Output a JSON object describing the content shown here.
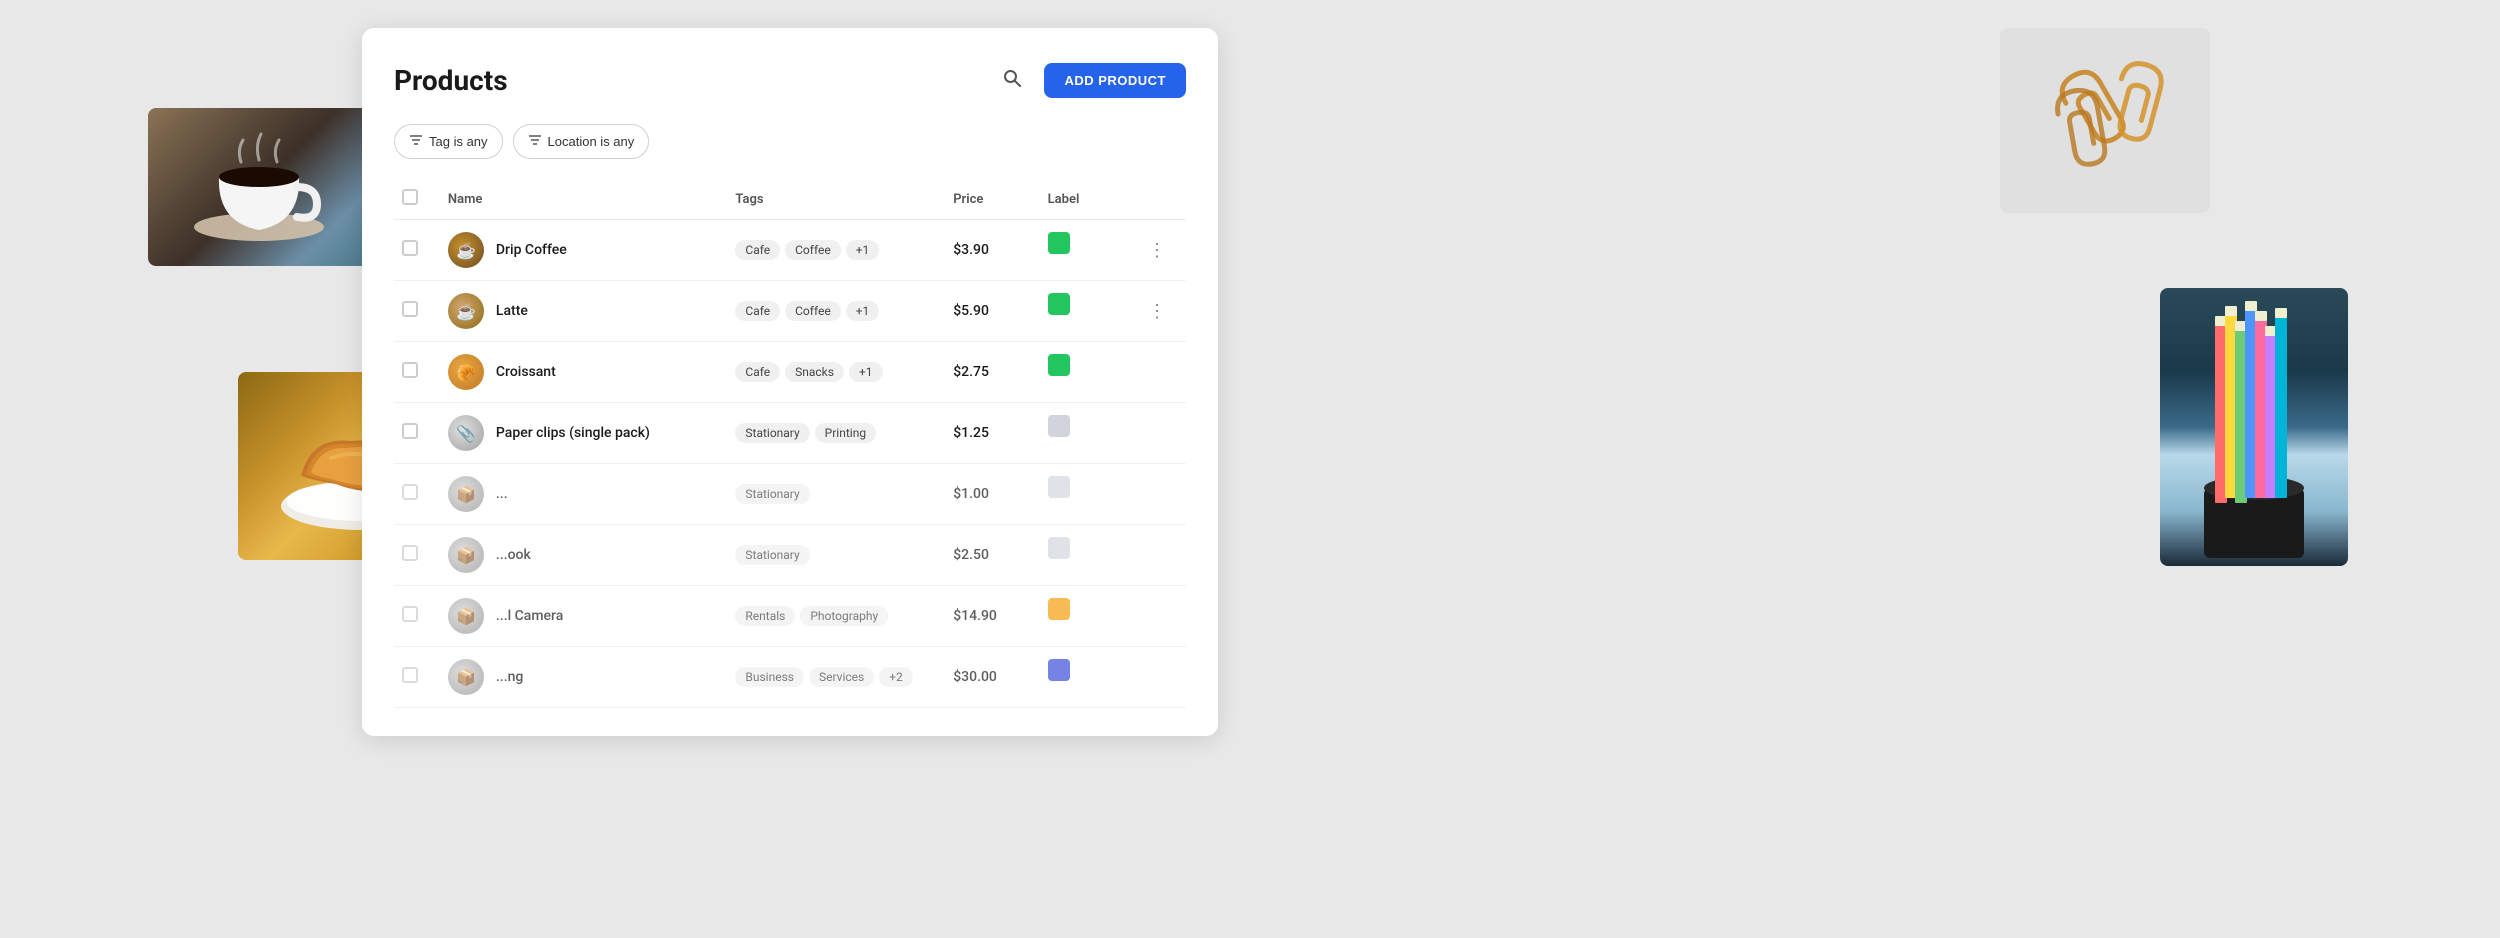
{
  "page": {
    "title": "Products",
    "add_button": "ADD PRODUCT"
  },
  "filters": [
    {
      "id": "tag",
      "label": "Tag is any"
    },
    {
      "id": "location",
      "label": "Location is any"
    }
  ],
  "table": {
    "columns": [
      "Name",
      "Tags",
      "Price",
      "Label"
    ],
    "rows": [
      {
        "id": 1,
        "name": "Drip Coffee",
        "avatar_type": "coffee",
        "tags": [
          "Cafe",
          "Coffee",
          "+1"
        ],
        "price": "$3.90",
        "label_color": "green",
        "has_menu": true
      },
      {
        "id": 2,
        "name": "Latte",
        "avatar_type": "latte",
        "tags": [
          "Cafe",
          "Coffee",
          "+1"
        ],
        "price": "$5.90",
        "label_color": "green",
        "has_menu": true
      },
      {
        "id": 3,
        "name": "Croissant",
        "avatar_type": "croissant",
        "tags": [
          "Cafe",
          "Snacks",
          "+1"
        ],
        "price": "$2.75",
        "label_color": "green",
        "has_menu": false
      },
      {
        "id": 4,
        "name": "Paper clips (single pack)",
        "avatar_type": "paperclip",
        "tags": [
          "Stationary",
          "Printing"
        ],
        "price": "$1.25",
        "label_color": "gray",
        "has_menu": false
      },
      {
        "id": 5,
        "name": "...",
        "avatar_type": "generic",
        "tags": [
          "Stationary"
        ],
        "price": "$1.00",
        "label_color": "gray",
        "has_menu": false,
        "truncated": true
      },
      {
        "id": 6,
        "name": "...ook",
        "avatar_type": "generic",
        "tags": [
          "Stationary"
        ],
        "price": "$2.50",
        "label_color": "gray",
        "has_menu": false,
        "truncated": true
      },
      {
        "id": 7,
        "name": "...l Camera",
        "avatar_type": "generic",
        "tags": [
          "Rentals",
          "Photography"
        ],
        "price": "$14.90",
        "label_color": "yellow",
        "has_menu": false,
        "truncated": true
      },
      {
        "id": 8,
        "name": "...ng",
        "avatar_type": "generic",
        "tags": [
          "Business",
          "Services",
          "+2"
        ],
        "price": "$30.00",
        "label_color": "blue",
        "has_menu": false,
        "truncated": true
      }
    ]
  },
  "icons": {
    "search": "🔍",
    "filter": "≡",
    "more": "⋮"
  }
}
